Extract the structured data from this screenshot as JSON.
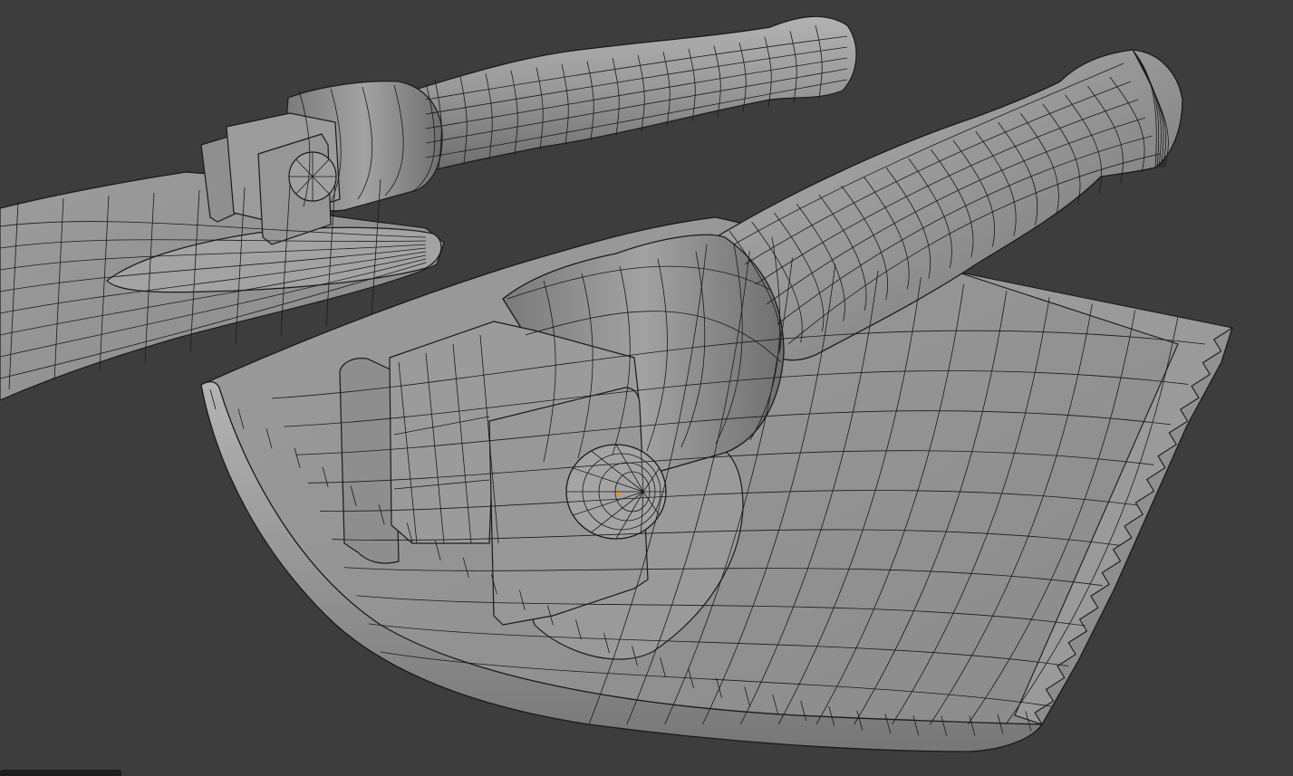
{
  "viewport": {
    "background_color": "#3d3d3d",
    "mesh_fill_color": "#8e8e8e",
    "mesh_light_color": "#a8a8a8",
    "mesh_dark_color": "#6e6e6e",
    "wire_color": "#1a1a1a",
    "selection_color": "#e8922a",
    "objects": [
      {
        "name": "axe-background",
        "parts": [
          "blade",
          "head-socket",
          "lug-plate",
          "bolt",
          "handle"
        ]
      },
      {
        "name": "axe-foreground",
        "parts": [
          "blade",
          "blade-rim",
          "head-socket",
          "lug-plate",
          "bolt",
          "handle",
          "serrated-edge"
        ]
      }
    ],
    "overlay": "wireframe"
  },
  "corner_tab": {
    "icon": "panel-tab-icon"
  }
}
